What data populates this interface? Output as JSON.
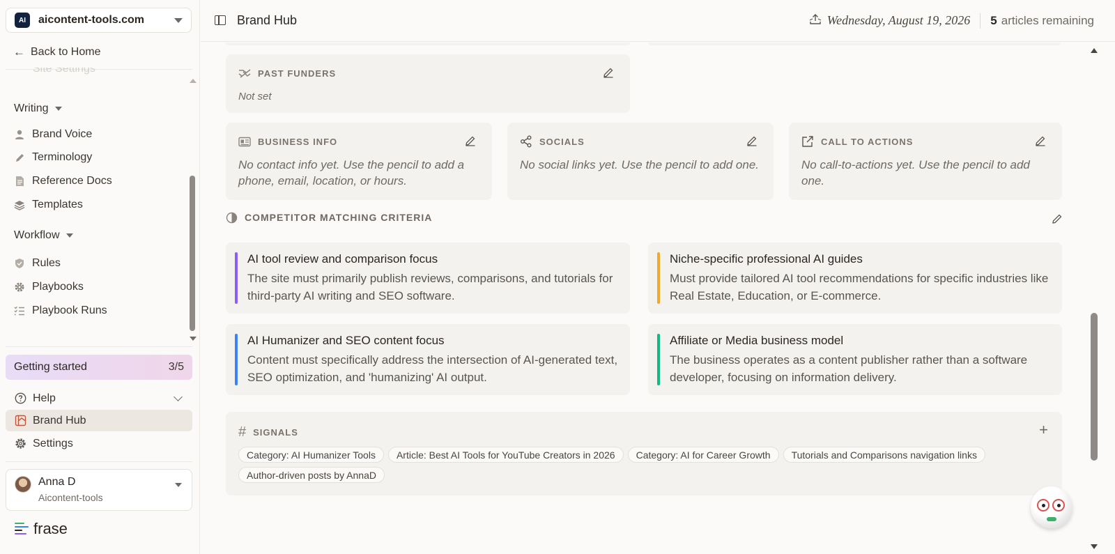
{
  "site": {
    "name": "aicontent-tools.com",
    "logo_text": "AI"
  },
  "sidebar": {
    "back_label": "Back to Home",
    "faded_item": "Site Settings",
    "groups": [
      {
        "title": "Writing",
        "items": [
          {
            "label": "Brand Voice",
            "icon": "person-icon"
          },
          {
            "label": "Terminology",
            "icon": "pen-icon"
          },
          {
            "label": "Reference Docs",
            "icon": "document-icon"
          },
          {
            "label": "Templates",
            "icon": "layers-icon"
          }
        ]
      },
      {
        "title": "Workflow",
        "items": [
          {
            "label": "Rules",
            "icon": "shield-icon"
          },
          {
            "label": "Playbooks",
            "icon": "gear-icon"
          },
          {
            "label": "Playbook Runs",
            "icon": "checklist-icon"
          }
        ]
      }
    ],
    "getting_started": {
      "label": "Getting started",
      "count": "3/5"
    },
    "bottom_items": [
      {
        "label": "Help",
        "icon": "help-icon"
      },
      {
        "label": "Brand Hub",
        "icon": "brand-hub-icon",
        "active": true
      },
      {
        "label": "Settings",
        "icon": "settings-icon"
      }
    ],
    "user": {
      "name": "Anna D",
      "org": "Aicontent-tools"
    },
    "brand": "frase"
  },
  "header": {
    "title": "Brand Hub",
    "date": "Wednesday, August 19, 2026",
    "articles_count": "5",
    "articles_label": "articles remaining"
  },
  "cards": {
    "past_funders": {
      "title": "PAST FUNDERS",
      "value": "Not set"
    },
    "business_info": {
      "title": "BUSINESS INFO",
      "value": "No contact info yet. Use the pencil to add a phone, email, location, or hours."
    },
    "socials": {
      "title": "SOCIALS",
      "value": "No social links yet. Use the pencil to add one."
    },
    "cta": {
      "title": "CALL TO ACTIONS",
      "value": "No call-to-actions yet. Use the pencil to add one."
    }
  },
  "competitor": {
    "title": "COMPETITOR MATCHING CRITERIA",
    "criteria": [
      {
        "title": "AI tool review and comparison focus",
        "desc": "The site must primarily publish reviews, comparisons, and tutorials for third-party AI writing and SEO software.",
        "color": "#8b5cf6"
      },
      {
        "title": "Niche-specific professional AI guides",
        "desc": "Must provide tailored AI tool recommendations for specific industries like Real Estate, Education, or E-commerce.",
        "color": "#f0a92e"
      },
      {
        "title": "AI Humanizer and SEO content focus",
        "desc": "Content must specifically address the intersection of AI-generated text, SEO optimization, and 'humanizing' AI output.",
        "color": "#3b82f6"
      },
      {
        "title": "Affiliate or Media business model",
        "desc": "The business operates as a content publisher rather than a software developer, focusing on information delivery.",
        "color": "#10b981"
      }
    ]
  },
  "signals": {
    "title": "SIGNALS",
    "chips": [
      "Category: AI Humanizer Tools",
      "Article: Best AI Tools for YouTube Creators in 2026",
      "Category: AI for Career Growth",
      "Tutorials and Comparisons navigation links",
      "Author-driven posts by AnnaD"
    ]
  }
}
